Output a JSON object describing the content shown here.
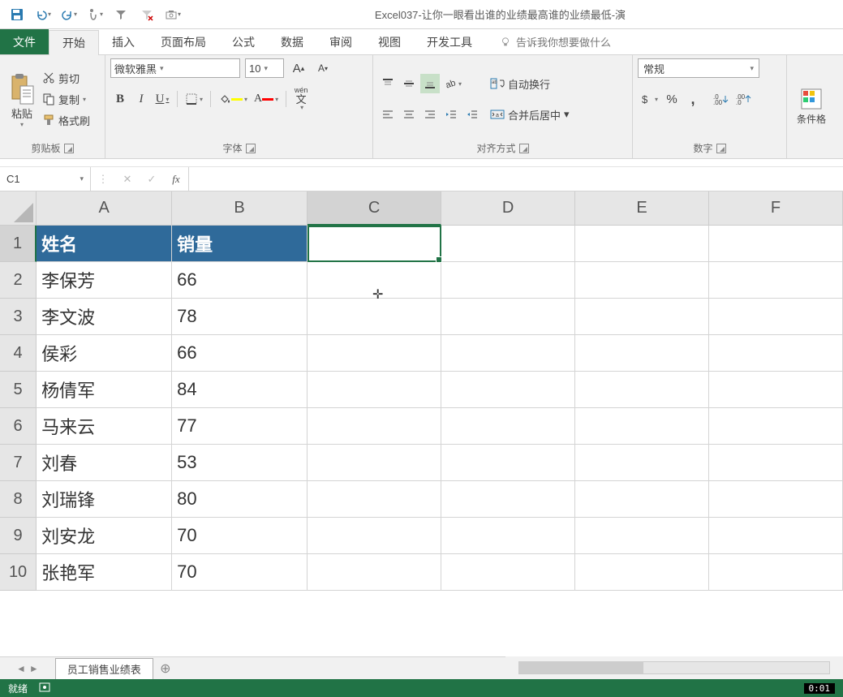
{
  "app": {
    "title": "Excel037-让你一眼看出谁的业绩最高谁的业绩最低-演"
  },
  "tabs": {
    "file": "文件",
    "home": "开始",
    "insert": "插入",
    "layout": "页面布局",
    "formulas": "公式",
    "data": "数据",
    "review": "审阅",
    "view": "视图",
    "developer": "开发工具",
    "tellme": "告诉我你想要做什么"
  },
  "clipboard": {
    "paste": "粘贴",
    "cut": "剪切",
    "copy": "复制",
    "format_painter": "格式刷",
    "group": "剪贴板"
  },
  "font": {
    "name": "微软雅黑",
    "size": "10",
    "group": "字体",
    "wen": "wén"
  },
  "align": {
    "wrap": "自动换行",
    "merge": "合并后居中",
    "group": "对齐方式"
  },
  "number": {
    "format": "常规",
    "group": "数字"
  },
  "styles": {
    "conditional": "条件格"
  },
  "namebox": "C1",
  "columns": [
    "A",
    "B",
    "C",
    "D",
    "E",
    "F"
  ],
  "rows": [
    {
      "n": "1",
      "a": "姓名",
      "b": "销量",
      "hdr": true
    },
    {
      "n": "2",
      "a": "李保芳",
      "b": "66"
    },
    {
      "n": "3",
      "a": "李文波",
      "b": "78"
    },
    {
      "n": "4",
      "a": "侯彩",
      "b": "66"
    },
    {
      "n": "5",
      "a": "杨倩军",
      "b": "84"
    },
    {
      "n": "6",
      "a": "马来云",
      "b": "77"
    },
    {
      "n": "7",
      "a": "刘春",
      "b": "53"
    },
    {
      "n": "8",
      "a": "刘瑞锋",
      "b": "80"
    },
    {
      "n": "9",
      "a": "刘安龙",
      "b": "70"
    },
    {
      "n": "10",
      "a": "张艳军",
      "b": "70"
    }
  ],
  "sheet": {
    "name": "员工销售业绩表"
  },
  "status": {
    "ready": "就绪",
    "timer": "0:01"
  }
}
